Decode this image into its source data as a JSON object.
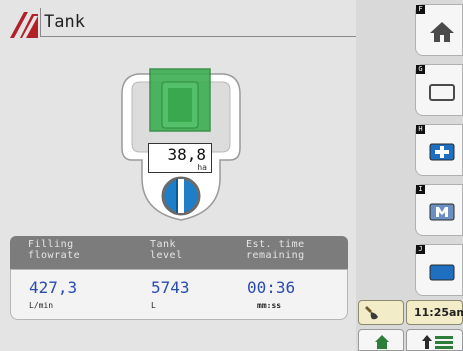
{
  "header": {
    "title": "Tank"
  },
  "tank_display": {
    "area_value": "38,8",
    "area_unit": "ha"
  },
  "info_panel": {
    "columns": [
      {
        "label": "Filling\nflowrate",
        "value": "427,3",
        "unit": "L/min"
      },
      {
        "label": "Tank\nlevel",
        "value": "5743",
        "unit": "L"
      },
      {
        "label": "Est. time\nremaining",
        "value": "00:36",
        "unit": "mm:ss"
      }
    ]
  },
  "softkeys": [
    {
      "letter": "F",
      "icon": "home-icon"
    },
    {
      "letter": "G",
      "icon": "blank-rect-icon"
    },
    {
      "letter": "H",
      "icon": "plus-icon"
    },
    {
      "letter": "I",
      "icon": "m-icon"
    },
    {
      "letter": "J",
      "icon": "blue-rect-icon"
    }
  ],
  "status": {
    "time": "11:25am",
    "icon": "brush-icon"
  },
  "bottom_bar": {
    "left_icon": "home-icon",
    "right_icon": "menu-arrow-icon"
  },
  "colors": {
    "accent_green": "#3cae52",
    "value_blue": "#2a4cb0",
    "logo_red": "#b3202a",
    "status_bg": "#f3ecc9"
  }
}
